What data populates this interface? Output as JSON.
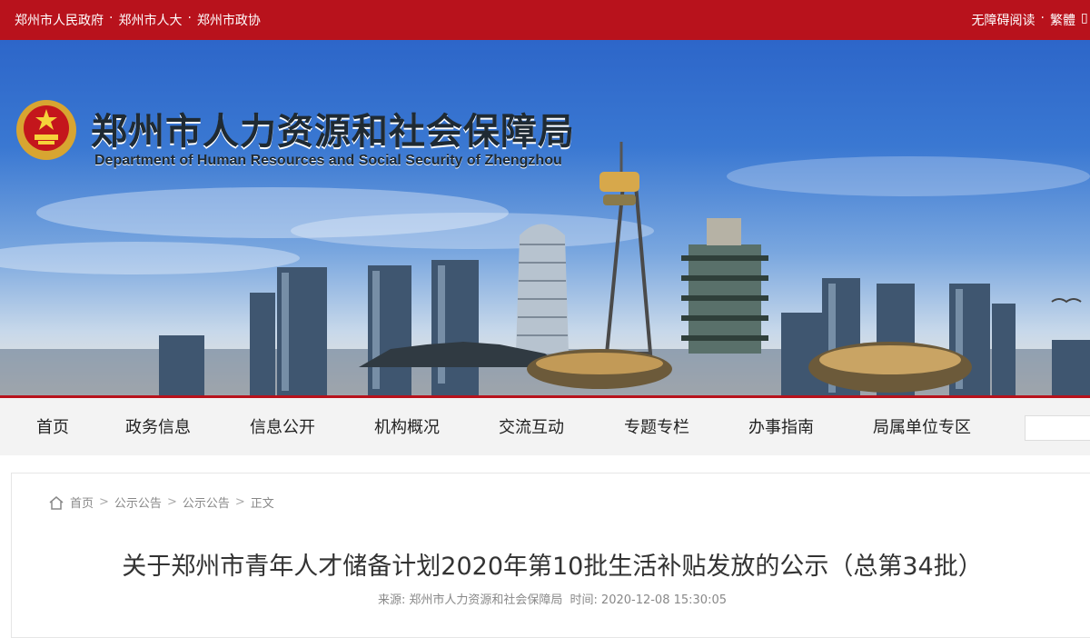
{
  "topbar": {
    "links": [
      "郑州市人民政府",
      "郑州市人大",
      "郑州市政协"
    ],
    "separator": "·",
    "right_links": [
      "无障碍阅读",
      "繁體"
    ]
  },
  "banner": {
    "title_cn": "郑州市人力资源和社会保障局",
    "title_en": "Department of Human Resources and Social Security of Zhengzhou"
  },
  "nav": {
    "items": [
      "首页",
      "政务信息",
      "信息公开",
      "机构概况",
      "交流互动",
      "专题专栏",
      "办事指南",
      "局属单位专区"
    ]
  },
  "breadcrumb": {
    "items": [
      "首页",
      "公示公告",
      "公示公告",
      "正文"
    ],
    "separator": ">"
  },
  "article": {
    "title": "关于郑州市青年人才储备计划2020年第10批生活补贴发放的公示（总第34批）",
    "source_label": "来源:",
    "source": "郑州市人力资源和社会保障局",
    "time_label": "时间:",
    "time": "2020-12-08 15:30:05"
  },
  "colors": {
    "brand_red": "#b8121c",
    "nav_bg": "#f3f3f3"
  }
}
